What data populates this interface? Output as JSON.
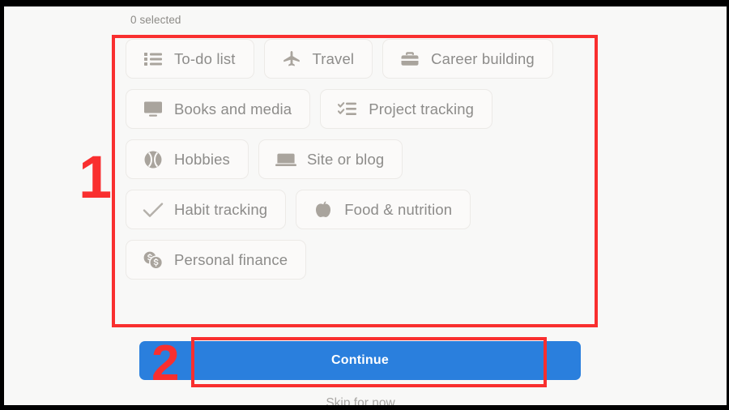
{
  "meta": {
    "accent_blue": "#2a7fdd",
    "annotation_red": "#f92f2f",
    "page_background": "#f8f8f7",
    "chip_background": "#fbfaf9",
    "chip_border": "#eceae7",
    "chip_text": "#8d8c8a"
  },
  "status": {
    "selected_count_label": "0 selected"
  },
  "chips": {
    "rows": [
      [
        {
          "label": "To-do list",
          "icon": "list-icon"
        },
        {
          "label": "Travel",
          "icon": "airplane-icon"
        },
        {
          "label": "Career building",
          "icon": "briefcase-icon"
        }
      ],
      [
        {
          "label": "Books and media",
          "icon": "monitor-icon"
        },
        {
          "label": "Project tracking",
          "icon": "checklist-icon"
        }
      ],
      [
        {
          "label": "Hobbies",
          "icon": "baseball-icon"
        },
        {
          "label": "Site or blog",
          "icon": "laptop-icon"
        }
      ],
      [
        {
          "label": "Habit tracking",
          "icon": "checkmark-icon"
        },
        {
          "label": "Food & nutrition",
          "icon": "apple-icon"
        }
      ],
      [
        {
          "label": "Personal finance",
          "icon": "coins-icon"
        }
      ]
    ]
  },
  "actions": {
    "continue_label": "Continue",
    "skip_label": "Skip for now"
  },
  "annotations": {
    "step_one": "1",
    "step_two": "2"
  }
}
